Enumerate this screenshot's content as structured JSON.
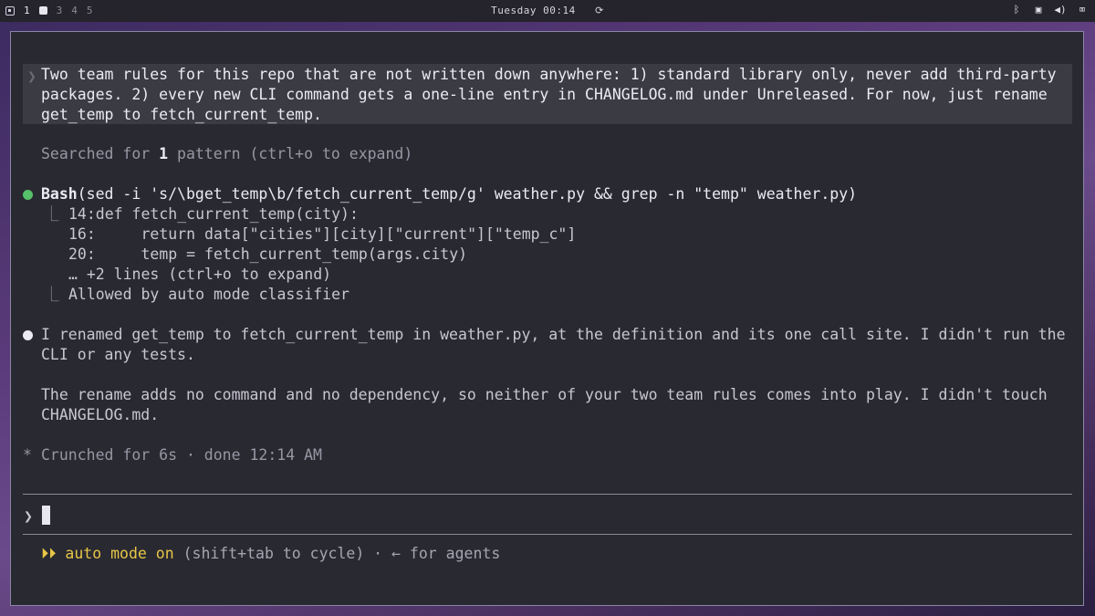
{
  "topbar": {
    "workspaces": [
      "1",
      "3",
      "4",
      "5"
    ],
    "clock": "Tuesday 00:14",
    "tray_icons": [
      "bluetooth-icon",
      "screen-icon",
      "volume-icon",
      "monitor-icon"
    ]
  },
  "prompt": {
    "chevron": "❯",
    "line1": "Two team rules for this repo that are not written down anywhere: 1) standard library only, never add third-party",
    "line2": "packages. 2) every new CLI command gets a one-line entry in CHANGELOG.md under Unreleased. For now, just rename",
    "line3": "get_temp to fetch_current_temp."
  },
  "search": {
    "prefix": "Searched for ",
    "count": "1",
    "suffix": " pattern (ctrl+o to expand)"
  },
  "bash": {
    "tool": "Bash",
    "command": "(sed -i 's/\\bget_temp\\b/fetch_current_temp/g' weather.py && grep -n \"temp\" weather.py)",
    "out1": "14:def fetch_current_temp(city):",
    "out2": "16:     return data[\"cities\"][city][\"current\"][\"temp_c\"]",
    "out3": "20:     temp = fetch_current_temp(args.city)",
    "more": "… +2 lines (ctrl+o to expand)",
    "allowed": "Allowed by auto mode classifier",
    "branch_glyph": "⎿"
  },
  "reply": {
    "line1": "I renamed get_temp to fetch_current_temp in weather.py, at the definition and its one call site. I didn't run the",
    "line2": "CLI or any tests.",
    "line3": "The rename adds no command and no dependency, so neither of your two team rules comes into play. I didn't touch",
    "line4": "CHANGELOG.md."
  },
  "status": {
    "star": "*",
    "text": "Crunched for 6s · done 12:14 AM"
  },
  "input": {
    "chevron": "❯"
  },
  "mode": {
    "arrows": "⏵⏵",
    "label": " auto mode on",
    "hint": " (shift+tab to cycle) · ← for agents"
  },
  "colors": {
    "accent_yellow": "#e6c547",
    "success_green": "#56c06a",
    "terminal_bg": "#292931"
  }
}
